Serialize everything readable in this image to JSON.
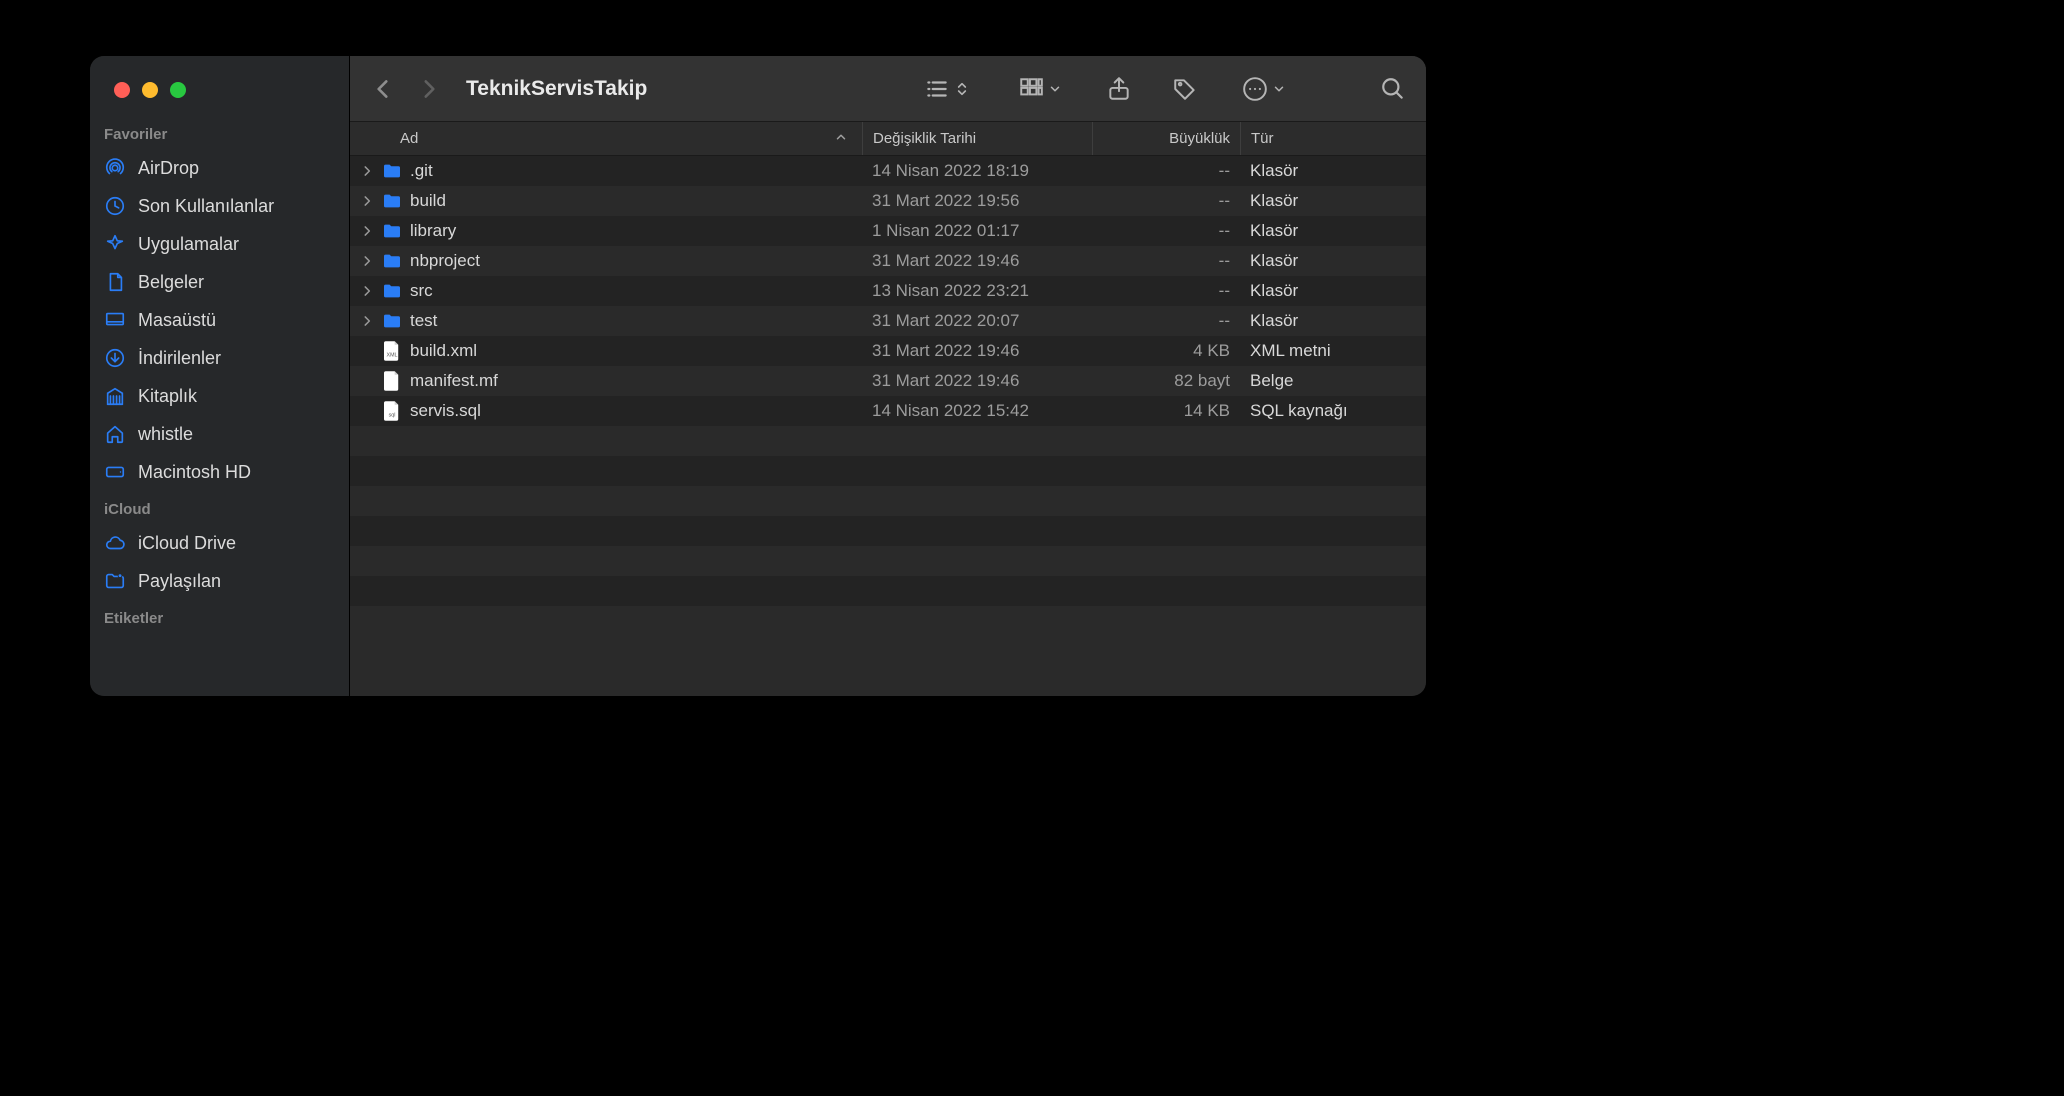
{
  "window_title": "TeknikServisTakip",
  "sidebar": {
    "sections": [
      {
        "label": "Favoriler",
        "items": [
          {
            "icon": "airdrop-icon",
            "label": "AirDrop"
          },
          {
            "icon": "clock-icon",
            "label": "Son Kullanılanlar"
          },
          {
            "icon": "apps-icon",
            "label": "Uygulamalar"
          },
          {
            "icon": "document-icon",
            "label": "Belgeler"
          },
          {
            "icon": "desktop-icon",
            "label": "Masaüstü"
          },
          {
            "icon": "download-icon",
            "label": "İndirilenler"
          },
          {
            "icon": "library-icon",
            "label": "Kitaplık"
          },
          {
            "icon": "home-icon",
            "label": "whistle"
          },
          {
            "icon": "disk-icon",
            "label": "Macintosh HD"
          }
        ]
      },
      {
        "label": "iCloud",
        "items": [
          {
            "icon": "cloud-icon",
            "label": "iCloud Drive"
          },
          {
            "icon": "shared-folder-icon",
            "label": "Paylaşılan"
          }
        ]
      },
      {
        "label": "Etiketler",
        "items": []
      }
    ]
  },
  "columns": {
    "name": "Ad",
    "date": "Değişiklik Tarihi",
    "size": "Büyüklük",
    "type": "Tür"
  },
  "files": [
    {
      "name": ".git",
      "date": "14 Nisan 2022 18:19",
      "size": "--",
      "type": "Klasör",
      "kind": "folder",
      "expandable": true
    },
    {
      "name": "build",
      "date": "31 Mart 2022 19:56",
      "size": "--",
      "type": "Klasör",
      "kind": "folder",
      "expandable": true
    },
    {
      "name": "library",
      "date": "1 Nisan 2022 01:17",
      "size": "--",
      "type": "Klasör",
      "kind": "folder",
      "expandable": true
    },
    {
      "name": "nbproject",
      "date": "31 Mart 2022 19:46",
      "size": "--",
      "type": "Klasör",
      "kind": "folder",
      "expandable": true
    },
    {
      "name": "src",
      "date": "13 Nisan 2022 23:21",
      "size": "--",
      "type": "Klasör",
      "kind": "folder",
      "expandable": true
    },
    {
      "name": "test",
      "date": "31 Mart 2022 20:07",
      "size": "--",
      "type": "Klasör",
      "kind": "folder",
      "expandable": true
    },
    {
      "name": "build.xml",
      "date": "31 Mart 2022 19:46",
      "size": "4 KB",
      "type": "XML metni",
      "kind": "xml",
      "expandable": false
    },
    {
      "name": "manifest.mf",
      "date": "31 Mart 2022 19:46",
      "size": "82 bayt",
      "type": "Belge",
      "kind": "doc",
      "expandable": false
    },
    {
      "name": "servis.sql",
      "date": "14 Nisan 2022 15:42",
      "size": "14 KB",
      "type": "SQL kaynağı",
      "kind": "sql",
      "expandable": false
    }
  ],
  "empty_rows": 6,
  "colors": {
    "folder": "#2a7df6",
    "doc_bg": "#ffffff",
    "doc_text": "#555555"
  }
}
